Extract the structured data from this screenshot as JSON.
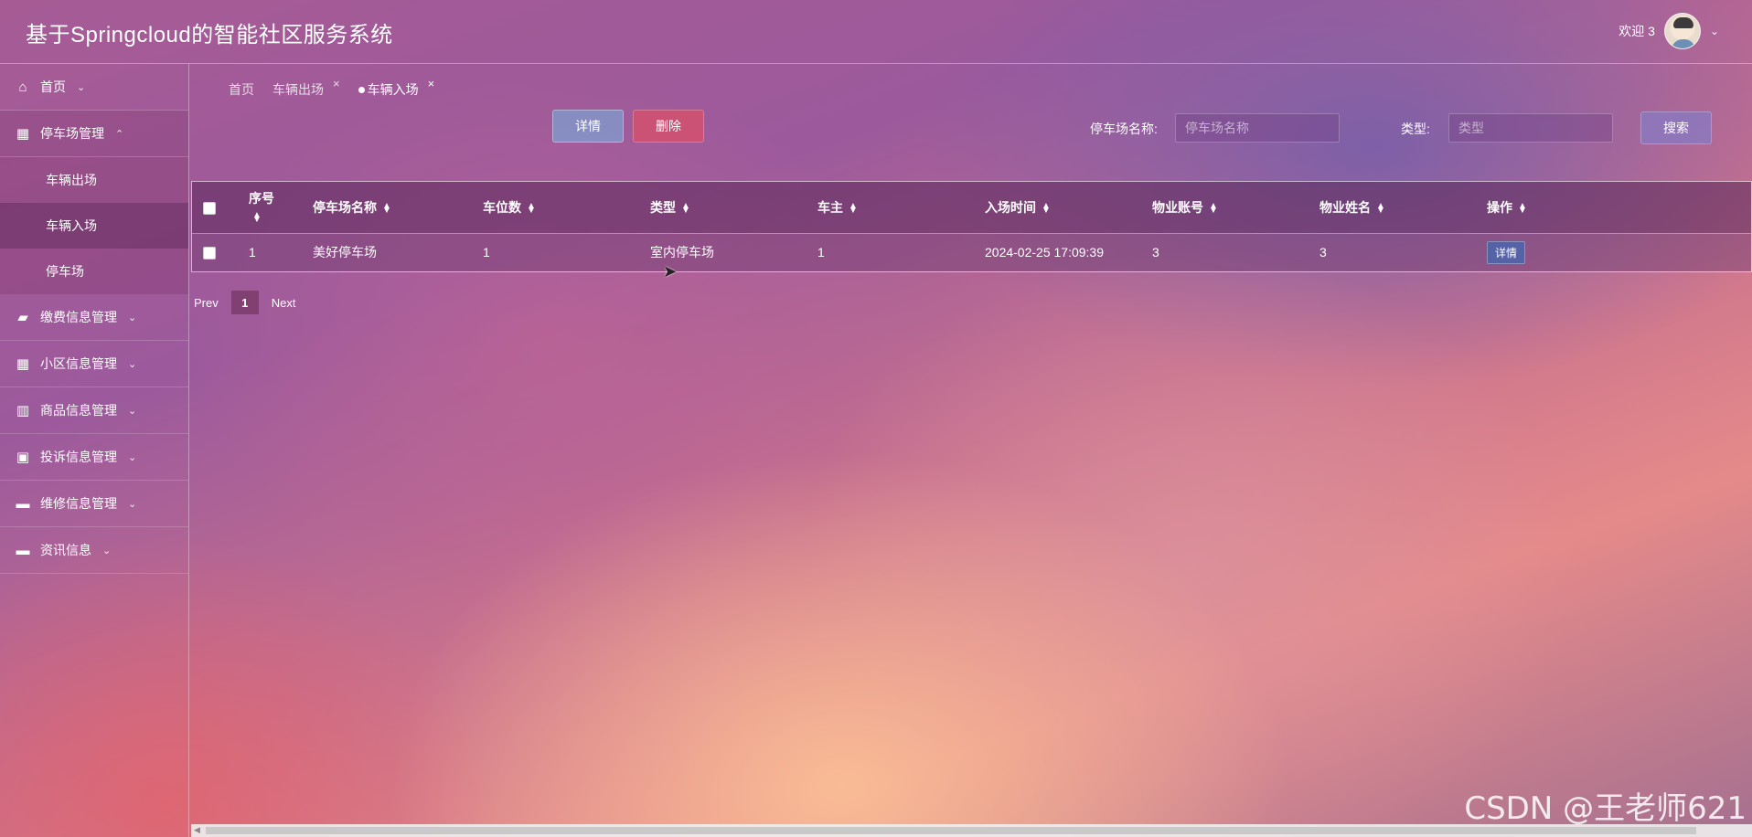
{
  "header": {
    "title": "基于Springcloud的智能社区服务系统",
    "welcome": "欢迎 3"
  },
  "sidebar": {
    "items": [
      {
        "label": "首页",
        "icon": "home-icon"
      },
      {
        "label": "停车场管理",
        "icon": "dashboard-icon",
        "open": true,
        "children": [
          {
            "label": "车辆出场"
          },
          {
            "label": "车辆入场",
            "active": true
          },
          {
            "label": "停车场"
          }
        ]
      },
      {
        "label": "缴费信息管理",
        "icon": "folder-icon"
      },
      {
        "label": "小区信息管理",
        "icon": "grid-icon"
      },
      {
        "label": "商品信息管理",
        "icon": "columns-icon"
      },
      {
        "label": "投诉信息管理",
        "icon": "image-icon"
      },
      {
        "label": "维修信息管理",
        "icon": "panel-icon"
      },
      {
        "label": "资讯信息",
        "icon": "panel-icon"
      }
    ]
  },
  "tabs": [
    {
      "label": "首页",
      "closable": false
    },
    {
      "label": "车辆出场",
      "closable": true
    },
    {
      "label": "车辆入场",
      "closable": true,
      "current": true
    }
  ],
  "toolbar": {
    "detail_label": "详情",
    "delete_label": "删除",
    "name_label": "停车场名称:",
    "name_placeholder": "停车场名称",
    "type_label": "类型:",
    "type_placeholder": "类型",
    "search_label": "搜索"
  },
  "table": {
    "columns": [
      "序号",
      "停车场名称",
      "车位数",
      "类型",
      "车主",
      "入场时间",
      "物业账号",
      "物业姓名",
      "操作"
    ],
    "rows": [
      [
        "1",
        "美好停车场",
        "1",
        "室内停车场",
        "1",
        "2024-02-25 17:09:39",
        "3",
        "3"
      ]
    ],
    "row_action_label": "详情"
  },
  "pagination": {
    "prev": "Prev",
    "current": "1",
    "next": "Next"
  },
  "watermark": "CSDN @王老师621"
}
